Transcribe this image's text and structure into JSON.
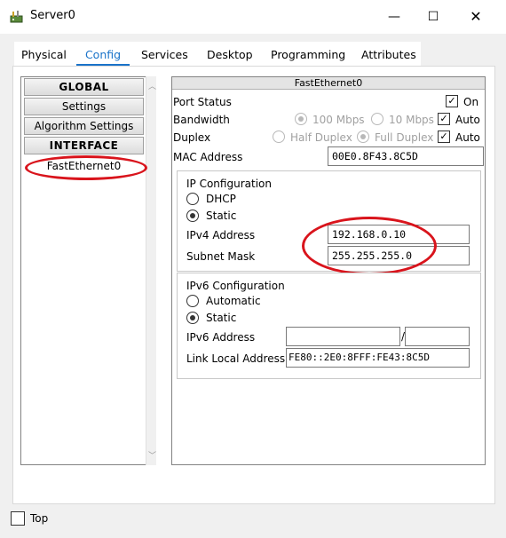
{
  "window": {
    "title": "Server0",
    "minimize": "—",
    "maximize": "☐",
    "close": "✕"
  },
  "tabs": [
    "Physical",
    "Config",
    "Services",
    "Desktop",
    "Programming",
    "Attributes"
  ],
  "active_tab": "Config",
  "nav": {
    "global": "GLOBAL",
    "settings": "Settings",
    "algorithm_settings": "Algorithm Settings",
    "interface": "INTERFACE",
    "fastethernet0": "FastEthernet0"
  },
  "panel": {
    "header": "FastEthernet0",
    "port_status": {
      "label": "Port Status",
      "on_label": "On",
      "checked": true
    },
    "bandwidth": {
      "label": "Bandwidth",
      "opt1": "100 Mbps",
      "opt2": "10 Mbps",
      "auto_label": "Auto",
      "auto_checked": true
    },
    "duplex": {
      "label": "Duplex",
      "opt1": "Half Duplex",
      "opt2": "Full Duplex",
      "auto_label": "Auto",
      "auto_checked": true
    },
    "mac": {
      "label": "MAC Address",
      "value": "00E0.8F43.8C5D"
    },
    "ipv4": {
      "title": "IP Configuration",
      "dhcp": "DHCP",
      "static": "Static",
      "address_label": "IPv4 Address",
      "address": "192.168.0.10",
      "mask_label": "Subnet Mask",
      "mask": "255.255.255.0"
    },
    "ipv6": {
      "title": "IPv6 Configuration",
      "automatic": "Automatic",
      "static": "Static",
      "address_label": "IPv6 Address",
      "address": "",
      "prefix_sep": "/",
      "prefix": "",
      "link_local_label": "Link Local Address:",
      "link_local": "FE80::2E0:8FFF:FE43:8C5D"
    }
  },
  "footer": {
    "top_label": "Top",
    "top_checked": false
  },
  "colors": {
    "accent": "#1a73c9",
    "highlight_oval": "#d9141c"
  },
  "icons": {
    "app": "router-icon",
    "check": "✓"
  }
}
